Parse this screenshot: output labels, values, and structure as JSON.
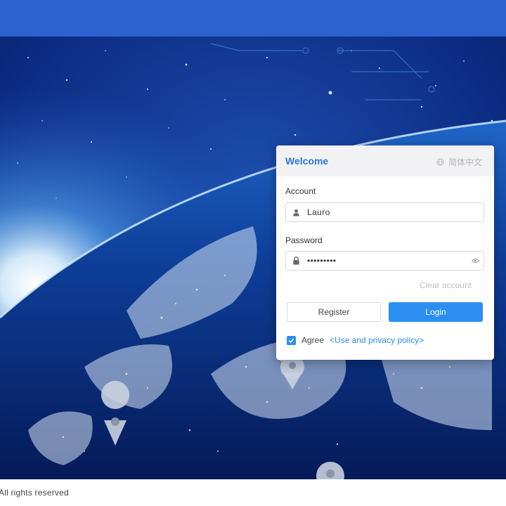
{
  "card": {
    "title": "Welcome",
    "language": "简体中文",
    "account_label": "Account",
    "account_value": "Lauro",
    "password_label": "Password",
    "password_value": "lauro1234",
    "clear_account": "Clear account",
    "register_label": "Register",
    "login_label": "Login",
    "agree_label": "Agree",
    "policy_link": "<Use and privacy policy>",
    "agree_checked": true
  },
  "footer": {
    "text": "All rights reserved"
  },
  "icons": {
    "language": "globe-icon",
    "account": "user-icon",
    "password": "lock-icon",
    "show_password": "eye-icon",
    "agree": "checkmark-icon"
  },
  "colors": {
    "top_bar": "#2b62cf",
    "accent": "#2b8ef0",
    "title": "#2e75d6"
  }
}
